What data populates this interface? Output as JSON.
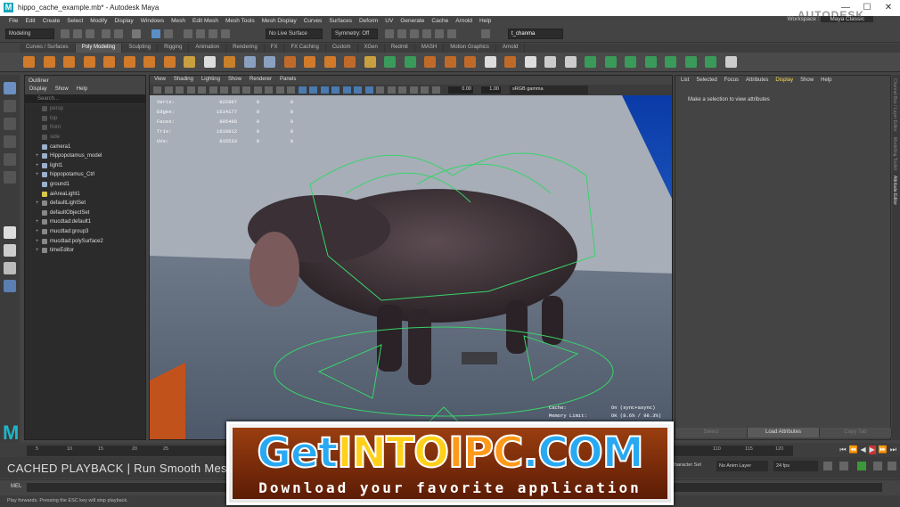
{
  "titlebar": {
    "title": "hippo_cache_example.mb* - Autodesk Maya",
    "min": "—",
    "max": "☐",
    "close": "✕"
  },
  "menubar": [
    "File",
    "Edit",
    "Create",
    "Select",
    "Modify",
    "Display",
    "Windows",
    "Mesh",
    "Edit Mesh",
    "Mesh Tools",
    "Mesh Display",
    "Curves",
    "Surfaces",
    "Deform",
    "UV",
    "Generate",
    "Cache",
    "Arnold",
    "Help"
  ],
  "workspace": {
    "label": "Workspace :",
    "value": "Maya Classic"
  },
  "brand": "AUTODESK",
  "statusline": {
    "mode": "Modeling",
    "live": "No Live Surface",
    "symmetry": "Symmetry: Off",
    "camera": "t_chanma"
  },
  "shelftabs": [
    "Curves / Surfaces",
    "Poly Modeling",
    "Sculpting",
    "Rigging",
    "Animation",
    "Rendering",
    "FX",
    "FX Caching",
    "Custom",
    "XGen",
    "Redmit",
    "MASH",
    "Motion Graphics",
    "Arnold"
  ],
  "outliner": {
    "title": "Outliner",
    "menu": [
      "Display",
      "Show",
      "Help"
    ],
    "search": "Search...",
    "items": [
      {
        "label": "persp",
        "dim": true,
        "exp": ""
      },
      {
        "label": "top",
        "dim": true,
        "exp": ""
      },
      {
        "label": "front",
        "dim": true,
        "exp": ""
      },
      {
        "label": "side",
        "dim": true,
        "exp": ""
      },
      {
        "label": "camera1",
        "dim": false,
        "exp": ""
      },
      {
        "label": "Hippopotamus_model",
        "dim": false,
        "exp": "+"
      },
      {
        "label": "light1",
        "dim": false,
        "exp": "+"
      },
      {
        "label": "hippopotamus_Ctrl",
        "dim": false,
        "exp": "+"
      },
      {
        "label": "ground1",
        "dim": false,
        "exp": ""
      },
      {
        "label": "aiAreaLight1",
        "dim": false,
        "exp": ""
      },
      {
        "label": "defaultLightSet",
        "dim": false,
        "exp": "+"
      },
      {
        "label": "defaultObjectSet",
        "dim": false,
        "exp": ""
      },
      {
        "label": "mucdtad:default1",
        "dim": false,
        "exp": "+"
      },
      {
        "label": "mucdtad:group3",
        "dim": false,
        "exp": "+"
      },
      {
        "label": "mucdtad:polySurface2",
        "dim": false,
        "exp": "+"
      },
      {
        "label": "timeEditor",
        "dim": false,
        "exp": "+"
      }
    ]
  },
  "viewport": {
    "menu": [
      "View",
      "Shading",
      "Lighting",
      "Show",
      "Renderer",
      "Panels"
    ],
    "gamma": "sRGB gamma",
    "exposure": "0.00",
    "gammaVal": "1.00",
    "hud": [
      {
        "label": "Verts:",
        "v": "822907",
        "a": "0",
        "b": "0"
      },
      {
        "label": "Edges:",
        "v": "1614177",
        "a": "0",
        "b": "0"
      },
      {
        "label": "Faces:",
        "v": "805466",
        "a": "0",
        "b": "0"
      },
      {
        "label": "Tris:",
        "v": "1610812",
        "a": "0",
        "b": "0"
      },
      {
        "label": "UVs:",
        "v": "815533",
        "a": "0",
        "b": "0"
      }
    ],
    "cache": {
      "label": "Cache:",
      "value": "On (sync+async)"
    },
    "memory": {
      "label": "Memory Limit:",
      "value": "OK (8.6% / 98.3%)"
    }
  },
  "attr": {
    "menu": [
      "List",
      "Selected",
      "Focus",
      "Attributes",
      "Display",
      "Show",
      "Help"
    ],
    "highlight": "Display",
    "message": "Make a selection to view attributes",
    "buttons": [
      "Select",
      "Load Attributes",
      "Copy Tab"
    ]
  },
  "sidetabs": [
    "Channel Box / Layer Editor",
    "Modelling Toolkit",
    "Attribute Editor"
  ],
  "timeline": {
    "ticks": [
      "5",
      "10",
      "15",
      "20",
      "25",
      "110",
      "115",
      "120"
    ],
    "current": "1"
  },
  "rangebar": {
    "charset": "Character Set",
    "animlayer": "No Anim Layer",
    "fps": "24 fps"
  },
  "caption": "CACHED PLAYBACK | Run Smooth Mesh",
  "cmdline": {
    "label": "MEL"
  },
  "helpline": "Play forwards. Pressing the ESC key will stop playback.",
  "banner": {
    "part1": "Get",
    "part2": "INTO",
    "part3": "IPC",
    ".com": ".COM",
    "sub": "Download your favorite application"
  },
  "logo": "M",
  "colors": {
    "maya": "#1aa5b8",
    "accent": "#ffdd55",
    "sky": "#2f6fd6"
  }
}
